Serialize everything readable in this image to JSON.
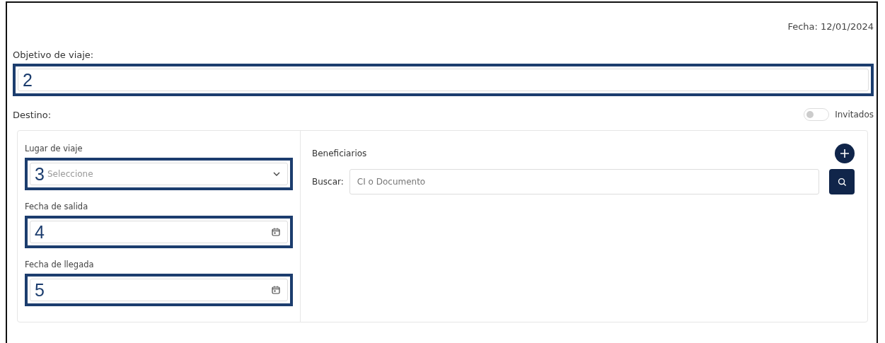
{
  "date": "Fecha: 12/01/2024",
  "objective": {
    "label": "Objetivo de viaje:",
    "callout": "2"
  },
  "destination": {
    "label": "Destino:"
  },
  "guests_toggle": {
    "label": "Invitados",
    "on": false
  },
  "trip_fields": [
    {
      "kind": "select",
      "label": "Lugar de viaje",
      "placeholder": "Seleccione",
      "callout": "3"
    },
    {
      "kind": "date",
      "label": "Fecha de salida",
      "callout": "4"
    },
    {
      "kind": "date",
      "label": "Fecha de llegada",
      "callout": "5"
    }
  ],
  "beneficiaries": {
    "title": "Beneficiarios",
    "search_label": "Buscar:",
    "search_placeholder": "CI o Documento"
  }
}
